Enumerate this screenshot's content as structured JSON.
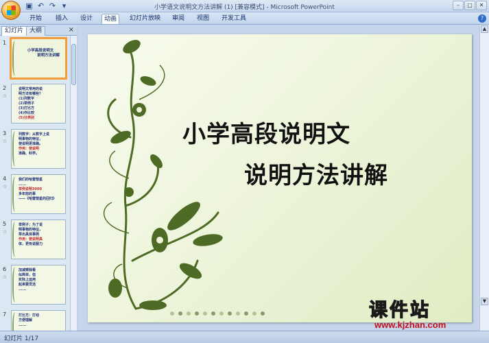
{
  "window": {
    "title": "小学语文说明文方法讲解 (1) [兼容模式] - Microsoft PowerPoint"
  },
  "ribbon": {
    "tabs": [
      "开始",
      "插入",
      "设计",
      "动画",
      "幻灯片放映",
      "审阅",
      "视图",
      "开发工具"
    ],
    "active_tab": "动画"
  },
  "left_pane": {
    "tabs": [
      "幻灯片",
      "大纲"
    ],
    "close": "×",
    "thumbnails": [
      {
        "num": "1",
        "lines": [
          "小学高段说明文",
          "说明方法讲解"
        ]
      },
      {
        "num": "2",
        "lines": [
          "说明文常用的说",
          "明方法有哪些？",
          "(1)列数字",
          "(2)举例子",
          "(3)打比方",
          "(4)作比较",
          "(5)分类别"
        ]
      },
      {
        "num": "3",
        "lines": [
          "列数字：从数字上说",
          "明事物的特征，",
          "使说明更准确。",
          "作用：使说明",
          "准确、科学。"
        ]
      },
      {
        "num": "4",
        "lines": [
          "我们的哈雷彗星",
          "......",
          "举例说明3000",
          "多年前的事",
          "——《哈雷彗星的回归》"
        ]
      },
      {
        "num": "5",
        "lines": [
          "举例子：为了说",
          "明事物的特征，",
          "举出具体事例",
          "作用：使说明具",
          "体，更有说服力"
        ]
      },
      {
        "num": "6",
        "lines": [
          "加减乘除看",
          "似简单，但",
          "实际上运用",
          "起来要灵活",
          "......"
        ]
      },
      {
        "num": "7",
        "lines": [
          "打比方：打动",
          "方便理解",
          "......"
        ]
      }
    ]
  },
  "slide": {
    "title": "小学高段说明文",
    "subtitle": "说明方法讲解"
  },
  "watermark": {
    "brand": "课件站",
    "url": "www.kjzhan.com"
  },
  "status": {
    "slide_counter": "幻灯片 1/17"
  },
  "colors": {
    "slide_bg": "#eef5dc",
    "vine": "#4e6b25",
    "selected_outline": "#f29b38",
    "watermark_yellow": "#f7e629",
    "watermark_red": "#c0101a"
  }
}
